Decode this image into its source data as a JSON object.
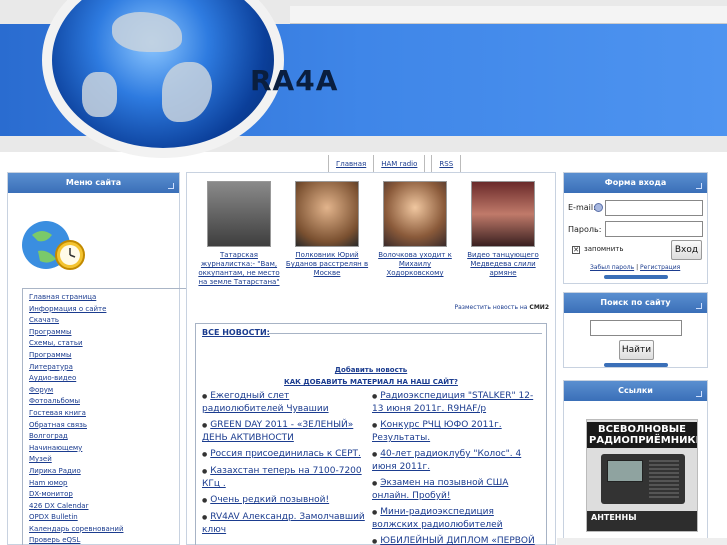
{
  "header": {
    "logo": "RA4A"
  },
  "topnav": {
    "items": [
      "Главная",
      "HAM radio",
      "RSS"
    ]
  },
  "left": {
    "title": "Меню сайта",
    "items": [
      "Главная страница",
      "Информация о сайте",
      "Скачать",
      "Программы",
      "Схемы, статьи",
      "Программы",
      "Литература",
      "Аудио-видео",
      "Форум",
      "Фотоальбомы",
      "Гостевая книга",
      "Обратная связь",
      "Волгоград",
      "Начинающему",
      "Музей",
      "Лирика Радио",
      "Ham юмор",
      "DX-монитор",
      "426 DX Calendar",
      "OPDX Bulletin",
      "Календарь соревнований",
      "Проверь eQSL"
    ]
  },
  "center": {
    "thumbs": [
      {
        "caption": "Татарская журналистка:- \"Вам, оккупантам, не место на земле Татарстана\""
      },
      {
        "caption": "Полковник Юрий Буданов расстрелян в Москве"
      },
      {
        "caption": "Волочкова уходит к Михаилу Ходорковскому"
      },
      {
        "caption": "Видео танцующего Медведева слили армяне"
      }
    ],
    "smi": {
      "prefix": "Разместить новость на",
      "brand": "СМИ2"
    },
    "news_header": "ВСЕ НОВОСТИ:",
    "add_news": "Добавить новость",
    "how_add": "КАК ДОБАВИТЬ МАТЕРИАЛ НА НАШ САЙТ?",
    "news_left": [
      "Ежегодный слет радиолюбителей Чувашии",
      "GREEN DAY 2011 - «ЗЕЛЕНЫЙ» ДЕНЬ АКТИВНОСТИ",
      "Россия присоединилась к СЕРТ.",
      "Казахстан теперь на 7100-7200 КГц .",
      "Очень редкий позывной!",
      "RV4AV Александр. Замолчавший ключ"
    ],
    "news_right": [
      "Радиоэкспедиция \"STALKER\" 12-13 июня 2011г. R9HAF/p",
      "Конкурс РЧЦ ЮФО 2011г. Результаты.",
      "40-лет радиоклубу \"Колос\". 4 июня 2011г.",
      "Экзамен на позывной США онлайн. Пробуй!",
      "Мини-радиоэкспедиция волжских радиолюбителей",
      "ЮБИЛЕЙНЫЙ ДИПЛОМ «ПЕРВОЙ ГРАЖДАНСКОЙ РАДИОСТАНЦИИ"
    ]
  },
  "login": {
    "title": "Форма входа",
    "email_label": "E-mail:",
    "password_label": "Пароль:",
    "remember_label": "запомнить",
    "login_button": "Вход",
    "forgot": "Забыл пароль",
    "separator": "|",
    "register": "Регистрация"
  },
  "search": {
    "title": "Поиск по сайту",
    "button": "Найти"
  },
  "links": {
    "title": "Ссылки",
    "ad_title": "ВСЕВОЛНОВЫЕ РАДИОПРИЁМНИКИ",
    "ad_bottom": "АНТЕННЫ"
  },
  "colors": {
    "accent": "#3a6fb8",
    "link": "#1b3c8f",
    "banner": "#3f86e8"
  }
}
